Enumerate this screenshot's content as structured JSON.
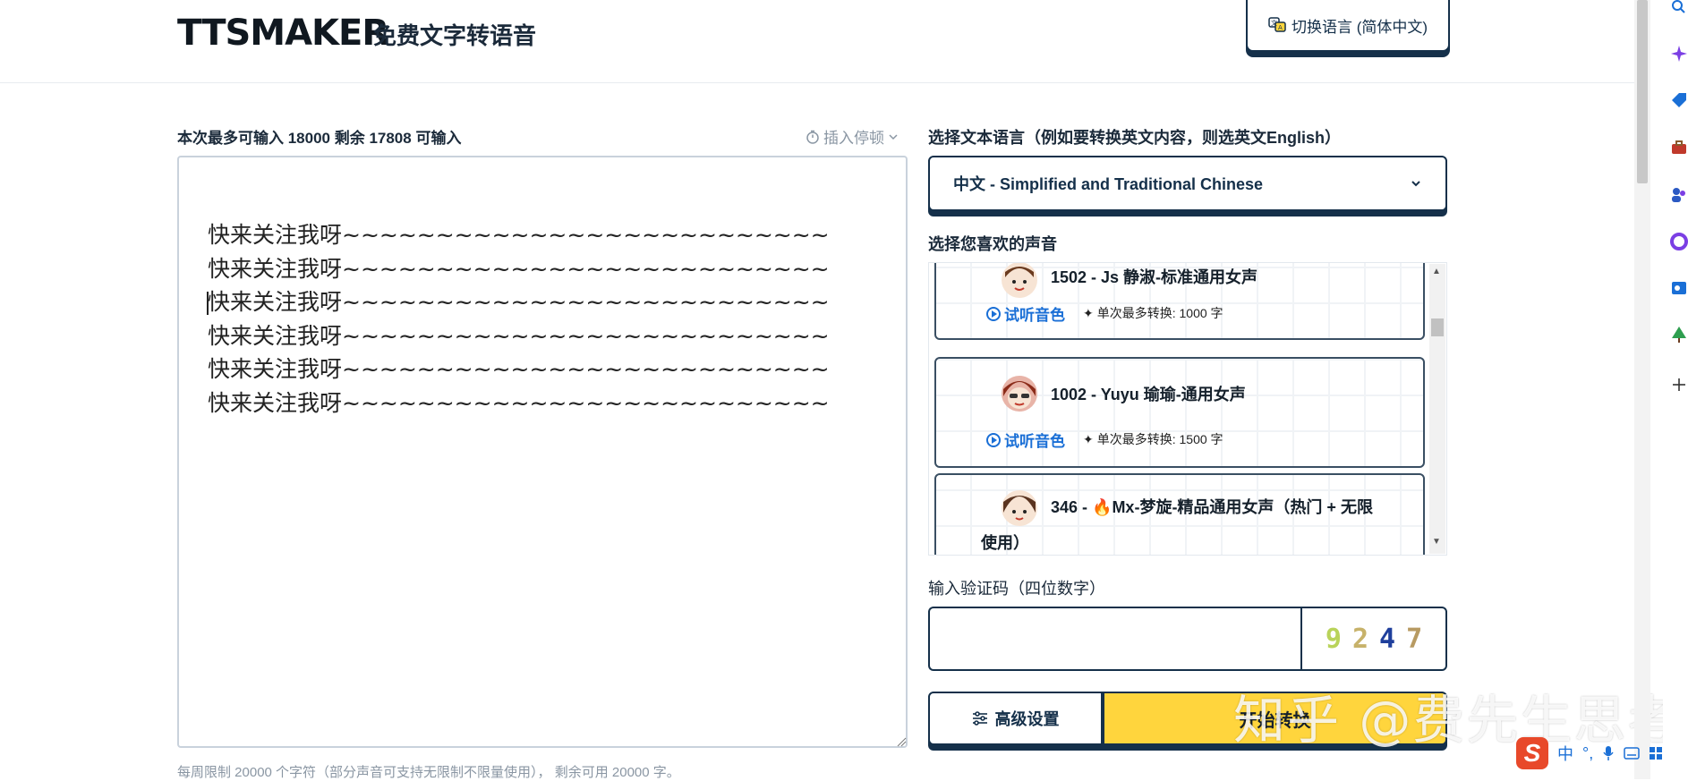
{
  "header": {
    "logo": "TTSMAKER",
    "subtitle": "免费文字转语音",
    "lang_switch_label": "切换语言 (简体中文)"
  },
  "input": {
    "limit_text": "本次最多可输入 18000 剩余 17808 可输入",
    "insert_pause_label": "插入停顿",
    "lines": [
      "快来关注我呀~~~~~~~~~~~~~~~~~~~~~~~~~~",
      "快来关注我呀~~~~~~~~~~~~~~~~~~~~~~~~~~",
      "快来关注我呀~~~~~~~~~~~~~~~~~~~~~~~~~~",
      "快来关注我呀~~~~~~~~~~~~~~~~~~~~~~~~~~",
      "快来关注我呀~~~~~~~~~~~~~~~~~~~~~~~~~~",
      "快来关注我呀~~~~~~~~~~~~~~~~~~~~~~~~~~"
    ],
    "footer_note": "每周限制 20000 个字符（部分声音可支持无限制不限量使用）， 剩余可用 20000 字。"
  },
  "language": {
    "title": "选择文本语言（例如要转换英文内容，则选英文English）",
    "selected": "中文 - Simplified and Traditional Chinese"
  },
  "voices": {
    "title": "选择您喜欢的声音",
    "items": [
      {
        "name": "1502 - Js 静淑-标准通用女声",
        "listen": "试听音色",
        "limit": "单次最多转换: 1000 字"
      },
      {
        "name": "1002 - Yuyu 瑜瑜-通用女声",
        "listen": "试听音色",
        "limit": "单次最多转换: 1500 字"
      },
      {
        "name": "346 - 🔥Mx-梦旋-精品通用女声（热门 + 无限使用）"
      }
    ]
  },
  "captcha": {
    "label": "输入验证码（四位数字）",
    "input_value": "",
    "digits": [
      "9",
      "2",
      "4",
      "7"
    ]
  },
  "actions": {
    "advanced_label": "高级设置",
    "convert_label": "开始转换"
  },
  "watermark": "知乎 @费先生思考",
  "ime": {
    "lang": "中"
  },
  "colors": {
    "accent": "#1a6fd6",
    "primary": "#15304a",
    "convert_bg": "#ffd53d"
  }
}
